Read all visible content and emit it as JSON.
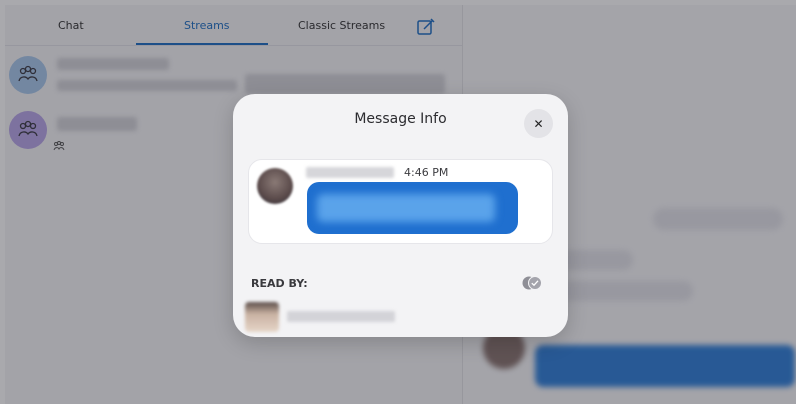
{
  "tabs": {
    "chat": "Chat",
    "streams": "Streams",
    "classic_streams": "Classic Streams",
    "active": "Streams"
  },
  "icons": {
    "compose": "compose-icon",
    "group": "group-icon",
    "close": "close-icon",
    "read_check": "double-check-icon"
  },
  "colors": {
    "accent": "#1d6fc4",
    "bubble": "#1f6fcf",
    "stream_avatar_1": "#a9c8ec",
    "stream_avatar_2": "#b9a6e8"
  },
  "modal": {
    "title": "Message Info",
    "close_glyph": "✕",
    "message": {
      "time": "4:46 PM"
    },
    "read_by_label": "READ BY:"
  }
}
